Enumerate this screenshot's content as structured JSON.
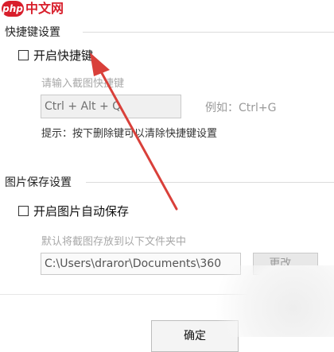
{
  "watermark": {
    "logo_text": "php",
    "site_text": "中文网"
  },
  "shortcut_section": {
    "title": "快捷键设置",
    "enable_label": "开启快捷键",
    "enabled": false,
    "input_hint": "请输入截图快捷键",
    "hotkey_value": "Ctrl + Alt + Q",
    "example_text": "例如：Ctrl+G",
    "tip_text": "提示：按下删除键可以清除快捷键设置"
  },
  "image_save_section": {
    "title": "图片保存设置",
    "enable_label": "开启图片自动保存",
    "enabled": false,
    "path_hint": "默认将截图存放到以下文件夹中",
    "path_value": "C:\\Users\\draror\\Documents\\360",
    "change_button": "更改..."
  },
  "footer": {
    "ok_button": "确定"
  },
  "colors": {
    "annotation_arrow": "#d9403a",
    "watermark": "#d81e2b"
  },
  "icons": [
    "php-logo-icon",
    "annotation-arrow-icon"
  ]
}
